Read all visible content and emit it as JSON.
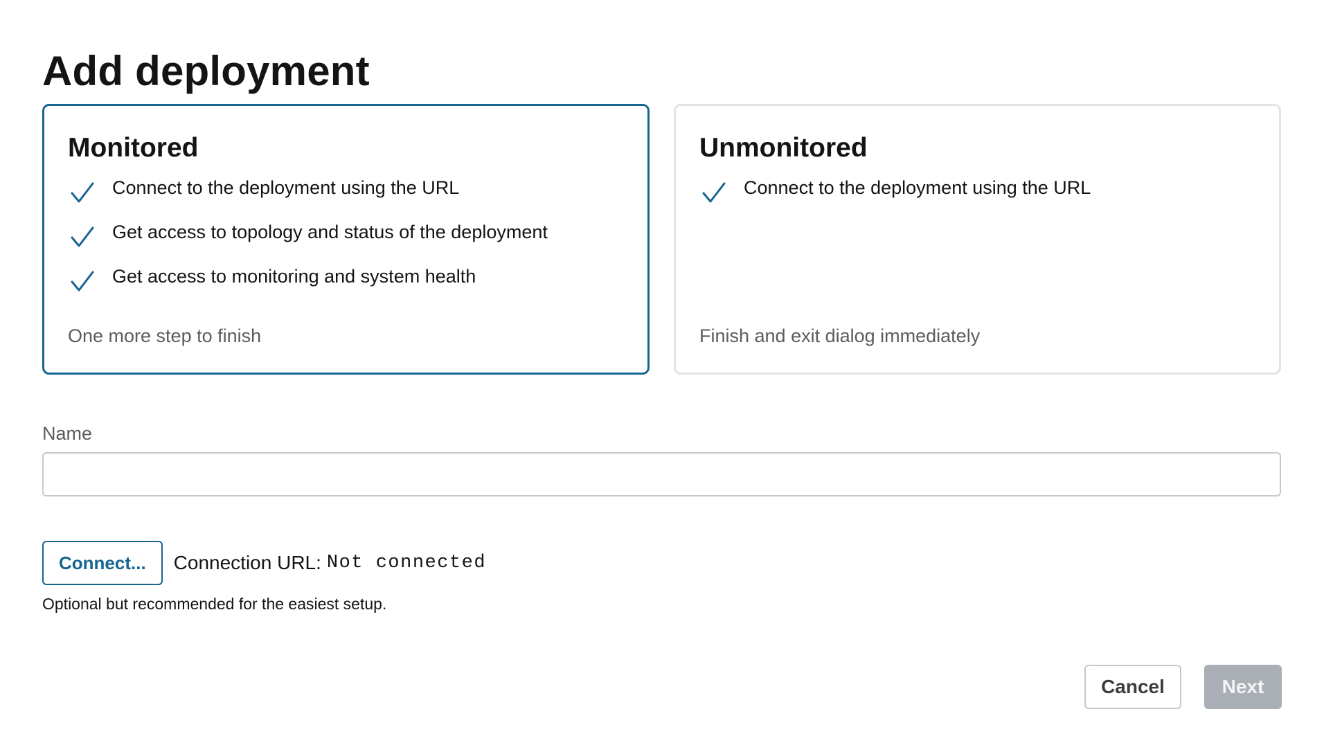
{
  "dialog": {
    "title": "Add deployment"
  },
  "options": [
    {
      "title": "Monitored",
      "selected": true,
      "features": [
        "Connect to the deployment using the URL",
        "Get access to topology and status of the deployment",
        "Get access to monitoring and system health"
      ],
      "footnote": "One more step to finish"
    },
    {
      "title": "Unmonitored",
      "selected": false,
      "features": [
        "Connect to the deployment using the URL"
      ],
      "footnote": "Finish and exit dialog immediately"
    }
  ],
  "form": {
    "name_label": "Name",
    "name_value": "",
    "connect_label": "Connect...",
    "connection_url_label": "Connection URL:",
    "connection_url_value": "Not connected",
    "hint": "Optional but recommended for the easiest setup."
  },
  "footer": {
    "cancel_label": "Cancel",
    "next_label": "Next",
    "next_disabled": true
  },
  "colors": {
    "accent": "#176591",
    "card_border": "#e3e3e3",
    "muted_text": "#5c5c5c",
    "disabled_button": "#a9afb5"
  },
  "icons": {
    "feature": "check-icon"
  }
}
